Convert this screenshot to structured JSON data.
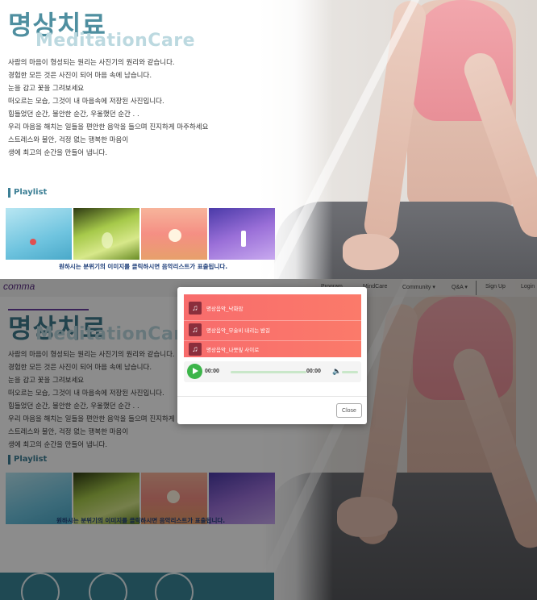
{
  "hero": {
    "title_ko": "명상치료",
    "title_en": "MeditationCare",
    "paragraph_lines": [
      "사람의 마음이 형성되는 원리는 사진기의 원리와 같습니다.",
      "경험한 모든 것은 사진이 되어 마음 속에 남습니다.",
      "눈을 감고 꽃을 그려보세요",
      "떠오르는 모습, 그것이 내 마음속에 저장된 사진입니다.",
      "힘들었던 순간, 불안한 순간, 우울했던 순간 . .",
      "우리 마음을 해치는 일들을 편안한 음악을 들으며 진지하게 마주하세요",
      "스트레스와 불안, 걱정 없는 행복한 마음이",
      "생에 최고의 순간을 만들어 냅니다."
    ]
  },
  "playlist": {
    "heading": "Playlist",
    "caption": "원하시는 분위기의 이미지를 클릭하시면 음악리스트가 표출됩니다."
  },
  "navbar": {
    "brand": "comma",
    "items": [
      "Program",
      "MindCare",
      "Community ▾",
      "Q&A ▾",
      "Sign Up",
      "Login"
    ]
  },
  "modal": {
    "tracks": [
      "명상음악_낙화암",
      "명상음악_무술비 내리는 밤길",
      "명상음악_나뭇잎 사이로"
    ],
    "player": {
      "current_time": "00:00",
      "duration": "00:00"
    },
    "close_label": "Close"
  },
  "colors": {
    "title": "#4f8fa0",
    "playlist_box": "#f86c6c",
    "play_button": "#3cb54a",
    "footer_band": "#3a8698"
  }
}
